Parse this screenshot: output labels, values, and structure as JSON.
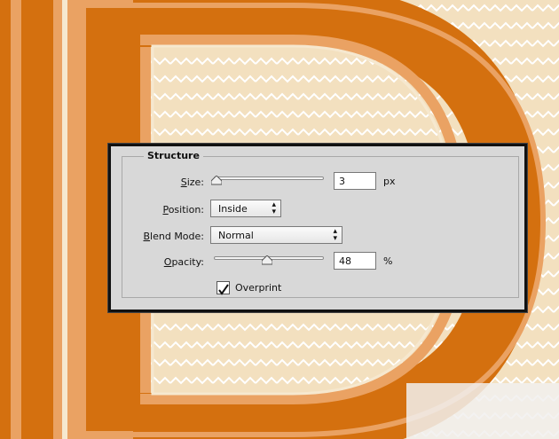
{
  "dialog": {
    "group_title": "Structure",
    "size": {
      "label_accel": "S",
      "label_rest": "ize:",
      "value": "3",
      "unit": "px",
      "level_percent": 0
    },
    "position": {
      "label_accel": "P",
      "label_rest": "osition:",
      "value": "Inside"
    },
    "blend_mode": {
      "label_accel": "B",
      "label_rest": "lend Mode:",
      "value": "Normal"
    },
    "opacity": {
      "label_accel": "O",
      "label_rest": "pacity:",
      "value": "48",
      "unit": "%",
      "level_percent": 48
    },
    "overprint": {
      "label": "Overprint",
      "checked": true
    }
  },
  "colors": {
    "orange": "#d4700f",
    "light_orange": "#eaa263",
    "cream": "#f3e0bf",
    "zigzag": "#ffffff"
  }
}
